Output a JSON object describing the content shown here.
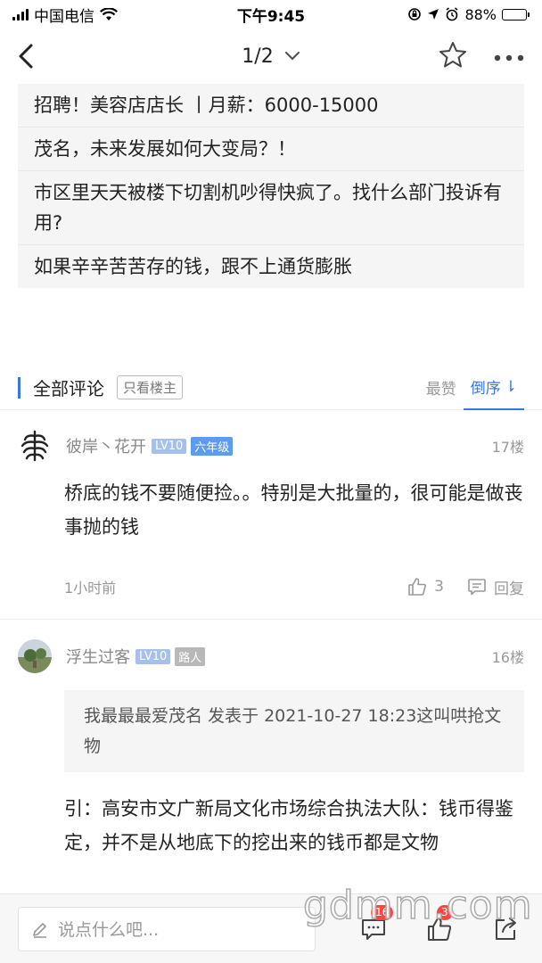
{
  "status": {
    "carrier": "中国电信",
    "time": "下午9:45",
    "battery": "88%",
    "battery_level": 0.88
  },
  "nav": {
    "page_indicator": "1/2",
    "icons": [
      "back-chevron-icon",
      "chevron-down-icon",
      "star-icon",
      "more-icon"
    ]
  },
  "related": [
    "招聘！美容店店长 丨月薪：6000-15000",
    "茂名，未来发展如何大变局？！",
    "市区里天天被楼下切割机吵得快疯了。找什么部门投诉有用?",
    "如果辛辛苦苦存的钱，跟不上通货膨胀"
  ],
  "comments_header": {
    "title": "全部评论",
    "only_op": "只看楼主",
    "sort_hot": "最赞",
    "sort_reverse": "倒序",
    "sort_reverse_icon": "⇂"
  },
  "comments": [
    {
      "username": "彼岸丶花开",
      "level": "LV10",
      "title": "六年级",
      "floor": "17楼",
      "body": "桥底的钱不要随便捡。。特别是大批量的，很可能是做丧事抛的钱",
      "time": "1小时前",
      "likes": "3",
      "reply": "回复"
    },
    {
      "username": "浮生过客",
      "level": "LV10",
      "title": "路人",
      "floor": "16楼",
      "quote": "我最最最爱茂名 发表于 2021-10-27 18:23这叫哄抢文物",
      "body": "引：高安市文广新局文化市场综合执法大队：钱币得鉴定，并不是从地底下的挖出来的钱币都是文物"
    }
  ],
  "bottom": {
    "placeholder": "说点什么吧...",
    "comment_count": "16",
    "like_count": "3"
  },
  "watermark": "gdmm.com",
  "colors": {
    "accent": "#3478e8",
    "level_badge": "#a7c0e8",
    "grade_badge": "#5b9cf0",
    "passerby_badge": "#b8b8b8",
    "badge_red": "#ff4444"
  }
}
